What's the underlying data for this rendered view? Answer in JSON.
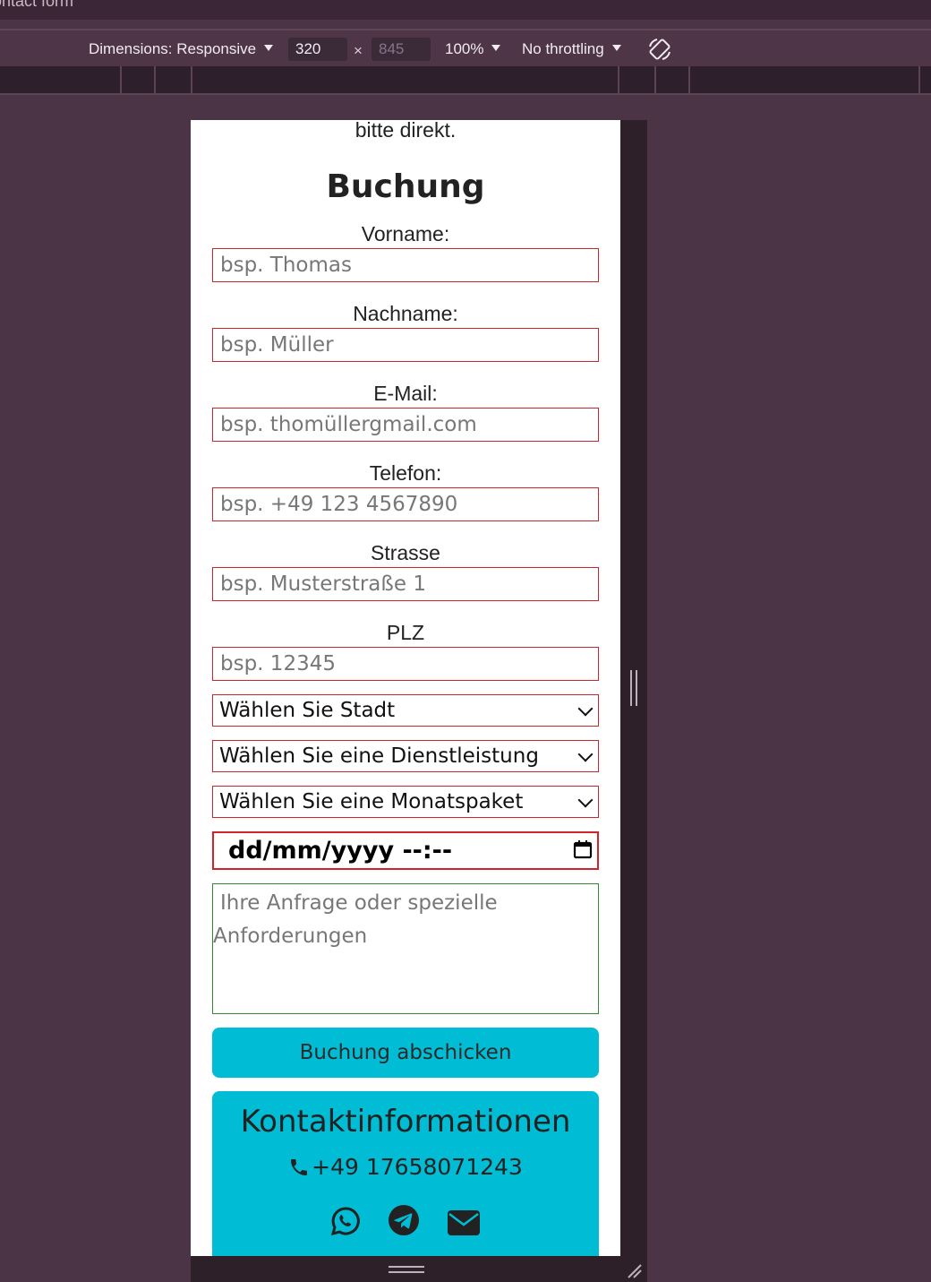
{
  "window": {
    "title": "ontact form"
  },
  "devtools": {
    "dimensions_label": "Dimensions: Responsive",
    "width_value": "320",
    "times_symbol": "×",
    "height_value": "845",
    "zoom_label": "100%",
    "throttling_label": "No throttling",
    "rotate_icon": "rotate-icon"
  },
  "page": {
    "intro_text": "bitte direkt.",
    "heading": "Buchung",
    "fields": {
      "vorname_label": "Vorname:",
      "vorname_placeholder": "bsp. Thomas",
      "nachname_label": "Nachname:",
      "nachname_placeholder": "bsp. Müller",
      "email_label": "E-Mail:",
      "email_placeholder": "bsp. thomüllergmail.com",
      "telefon_label": "Telefon:",
      "telefon_placeholder": "bsp. +49 123 4567890",
      "strasse_label": "Strasse",
      "strasse_placeholder": "bsp. Musterstraße 1",
      "plz_label": "PLZ",
      "plz_placeholder": "bsp. 12345"
    },
    "selects": {
      "stadt": "Wählen Sie Stadt",
      "dienstleistung": "Wählen Sie eine Dienstleistung",
      "monatspaket": "Wählen Sie eine Monatspaket"
    },
    "datetime_value": "dd/mm/yyyy --:--",
    "textarea_placeholder_line1": "Ihre Anfrage oder spezielle",
    "textarea_placeholder_line2": "Anforderungen",
    "submit_label": "Buchung abschicken",
    "contact": {
      "title": "Kontaktinformationen",
      "phone": "+49 17658071243",
      "icons": [
        "whatsapp-icon",
        "telegram-icon",
        "mail-icon"
      ]
    }
  },
  "colors": {
    "accent": "#00bcd4",
    "input_border": "#d0232a",
    "textarea_border": "#2e8b2e",
    "devtools_bg": "#4b3446"
  }
}
